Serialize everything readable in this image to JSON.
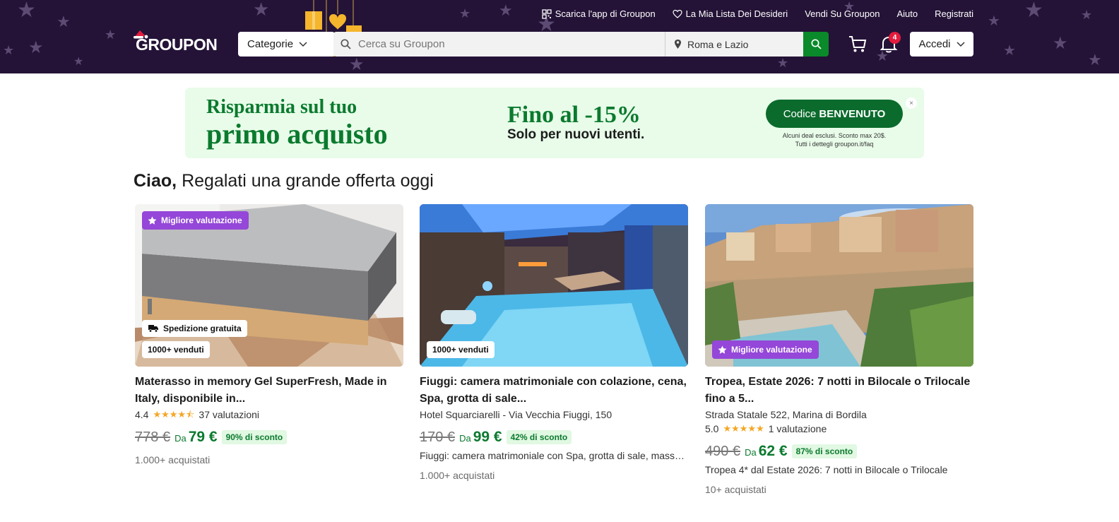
{
  "header": {
    "topnav": {
      "app": "Scarica l'app di Groupon",
      "wishlist": "La Mia Lista Dei Desideri",
      "sell": "Vendi Su Groupon",
      "help": "Aiuto",
      "register": "Registrati"
    },
    "logo": "GROUPON",
    "categories_label": "Categorie",
    "search_placeholder": "Cerca su Groupon",
    "location": "Roma e Lazio",
    "notification_count": "4",
    "login_label": "Accedi"
  },
  "promo": {
    "line1": "Risparmia sul tuo",
    "line2": "primo acquisto",
    "headline": "Fino al -15%",
    "subline": "Solo per nuovi utenti.",
    "code_prefix": "Codice",
    "code": "BENVENUTO",
    "fine1": "Alcuni deal esclusi. Sconto max 20$.",
    "fine2": "Tutti i dettegli groupon.it/faq",
    "close": "×"
  },
  "greeting": {
    "name": "Ciao,",
    "text": "Regalati una grande offerta oggi"
  },
  "deals": [
    {
      "badge_top": "Migliore valutazione",
      "badge_ship": "Spedizione gratuita",
      "badge_sold": "1000+ venduti",
      "title": "Materasso in memory Gel SuperFresh, Made in Italy, disponibile in...",
      "rating": "4.4",
      "stars": "★★★★⯪",
      "reviews": "37 valutazioni",
      "old_price": "778 €",
      "from": "Da",
      "price": "79 €",
      "discount": "90% di sconto",
      "bought": "1.000+ acquistati"
    },
    {
      "badge_sold": "1000+ venduti",
      "title": "Fiuggi: camera matrimoniale con colazione, cena, Spa, grotta di sale...",
      "location": "Hotel Squarciarelli - Via Vecchia Fiuggi, 150",
      "old_price": "170 €",
      "from": "Da",
      "price": "99 €",
      "discount": "42% di sconto",
      "desc": "Fiuggi: camera matrimoniale con Spa, grotta di sale, massaggio e cena",
      "bought": "1.000+ acquistati"
    },
    {
      "badge_top": "Migliore valutazione",
      "title": "Tropea, Estate 2026: 7 notti in Bilocale o Trilocale fino a 5...",
      "location": "Strada Statale 522, Marina di Bordila",
      "rating": "5.0",
      "stars": "★★★★★",
      "reviews": "1 valutazione",
      "old_price": "490 €",
      "from": "Da",
      "price": "62 €",
      "discount": "87% di sconto",
      "desc": "Tropea 4* dal Estate 2026: 7 notti in Bilocale o Trilocale",
      "bought": "10+ acquistati"
    }
  ]
}
